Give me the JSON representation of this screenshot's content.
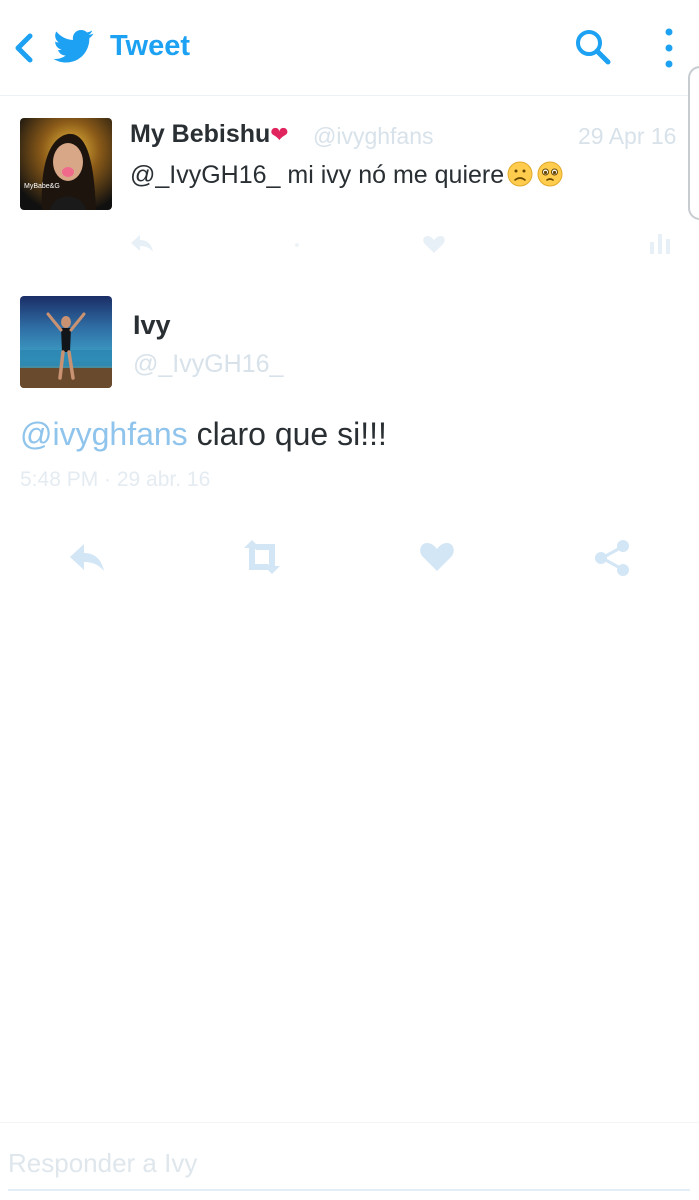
{
  "header": {
    "title": "Tweet",
    "back_icon": "chevron-left-icon",
    "logo_icon": "twitter-bird-icon",
    "search_icon": "search-icon",
    "more_icon": "more-vertical-icon"
  },
  "parent_tweet": {
    "display_name": "My Bebishu",
    "name_emoji": "❤",
    "handle": "@ivyghfans",
    "date": "29 Apr 16",
    "text": "@_IvyGH16_ mi ivy nó me quiere",
    "emojis": [
      "slightly-frowning-face",
      "pleading-face"
    ],
    "avatar_caption": "MyBabe&G",
    "actions": [
      "reply-icon",
      "retweet-icon",
      "like-icon",
      "analytics-icon"
    ]
  },
  "main_tweet": {
    "display_name": "Ivy",
    "handle": "@_IvyGH16_",
    "mention": "@ivyghfans",
    "text": " claro que si!!!",
    "meta": "5:48 PM · 29 abr. 16",
    "actions": [
      "reply-icon",
      "retweet-icon",
      "like-icon",
      "share-icon"
    ]
  },
  "reply_bar": {
    "placeholder": "Responder a Ivy"
  },
  "colors": {
    "accent": "#1da1f2",
    "text": "#292f33",
    "muted": "#d8e2ea",
    "heart": "#e0245e",
    "action_icon": "#d3e6f5"
  }
}
